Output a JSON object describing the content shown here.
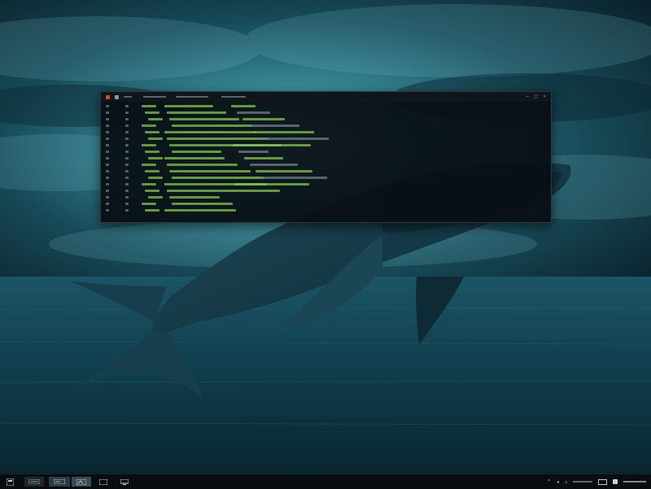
{
  "colors": {
    "sky_top": "#0b2630",
    "sky_glow": "#5fb9c7",
    "sea": "#0d3e4e",
    "whale": "#143846",
    "terminal_bg": "#080e14",
    "terminal_text_green": "#7fc74a",
    "terminal_text_gray": "#6f7f86",
    "terminal_close": "#d9492b",
    "taskbar_bg": "#090d10"
  },
  "terminal": {
    "title_icons": [
      "terminal-icon",
      "tab-icon"
    ],
    "window_controls": [
      "minimize-icon",
      "maximize-icon",
      "close-icon"
    ]
  },
  "taskbar": {
    "start_icon": "start-icon",
    "apps": [
      {
        "name": "file-explorer-icon",
        "label": ""
      },
      {
        "name": "terminal-app-icon",
        "label": ""
      },
      {
        "name": "app-icon",
        "label": ""
      },
      {
        "name": "window-icon",
        "label": ""
      },
      {
        "name": "monitor-icon",
        "label": ""
      }
    ],
    "tray_icons": [
      "chevron-up-icon",
      "network-icon",
      "volume-icon",
      "battery-icon",
      "notification-icon"
    ]
  }
}
